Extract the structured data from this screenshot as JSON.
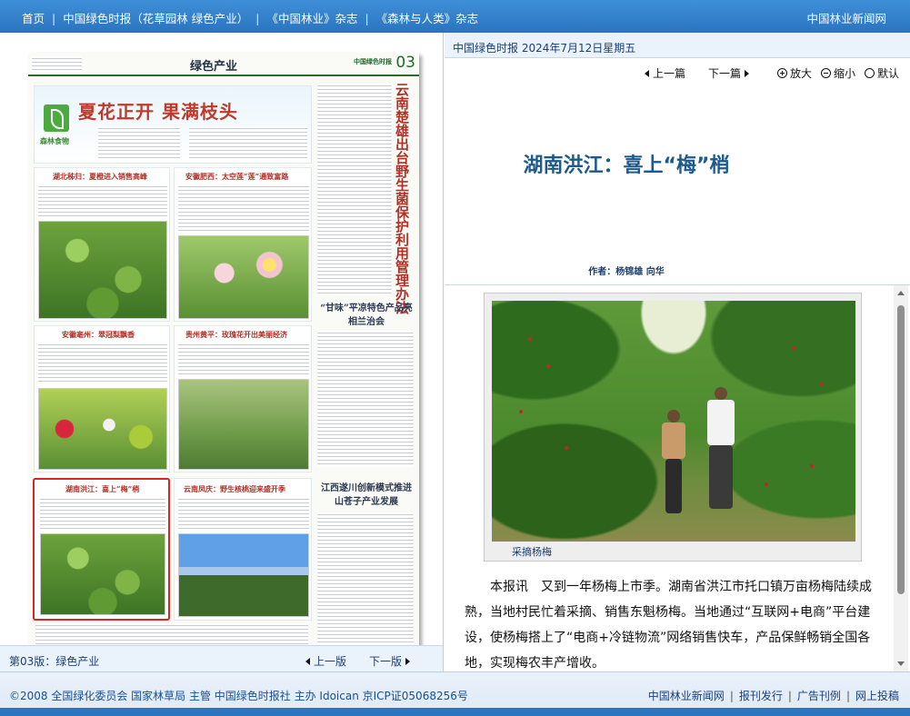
{
  "nav": {
    "items": [
      "首页",
      "中国绿色时报（花草园林 绿色产业）",
      "《中国林业》杂志",
      "《森林与人类》杂志"
    ],
    "separator": "|",
    "brand": "中国林业新闻网"
  },
  "newspaper": {
    "section": "绿色产业",
    "logo": "中国绿色时报",
    "page_no": "03",
    "banner_title": "夏花正开 果满枝头",
    "banner_tag": "森林食物",
    "headlines": [
      "湖北秭归：夏橙进入销售高峰",
      "安徽肥西：太空莲“莲”通致富路",
      "安徽亳州：翠冠梨飘香",
      "贵州黄平：玫瑰花开出美丽经济",
      "湖南洪江：喜上“梅”梢",
      "云南凤庆：野生核桃迎来盛开季"
    ],
    "vertical_title": "云南楚雄出台野生菌保护利用管理办法",
    "side_title_1": "“甘味”平凉特色产品亮相兰治会",
    "side_title_2": "江西遂川创新模式推进山苍子产业发展"
  },
  "left_footer": {
    "edition": "第03版：绿色产业",
    "prev": "上一版",
    "next": "下一版"
  },
  "article_header": {
    "paper_date": "中国绿色时报   2024年7月12日星期五",
    "prev": "上一篇",
    "next": "下一篇",
    "zoom_in": "放大",
    "zoom_out": "缩小",
    "default": "默认"
  },
  "article": {
    "title": "湖南洪江：喜上“梅”梢",
    "author": "作者：杨锦雄 向华",
    "photo_caption": "采摘杨梅",
    "body": "本报讯　又到一年杨梅上市季。湖南省洪江市托口镇万亩杨梅陆续成熟，当地村民忙着采摘、销售东魁杨梅。当地通过“互联网+电商”平台建设，使杨梅搭上了“电商+冷链物流”网络销售快车，产品保鲜畅销全国各地，实现梅农丰产增收。"
  },
  "footer": {
    "copyright": "©2008 全国绿化委员会  国家林草局 主管 中国绿色时报社 主办 Idoican 京ICP证05068256号",
    "links": [
      "中国林业新闻网",
      "报刊发行",
      "广告刊例",
      "网上投稿"
    ]
  },
  "colors": {
    "header_blue": "#2a74c0",
    "title_blue": "#1c5a8e",
    "highlight_red": "#d6281f"
  }
}
